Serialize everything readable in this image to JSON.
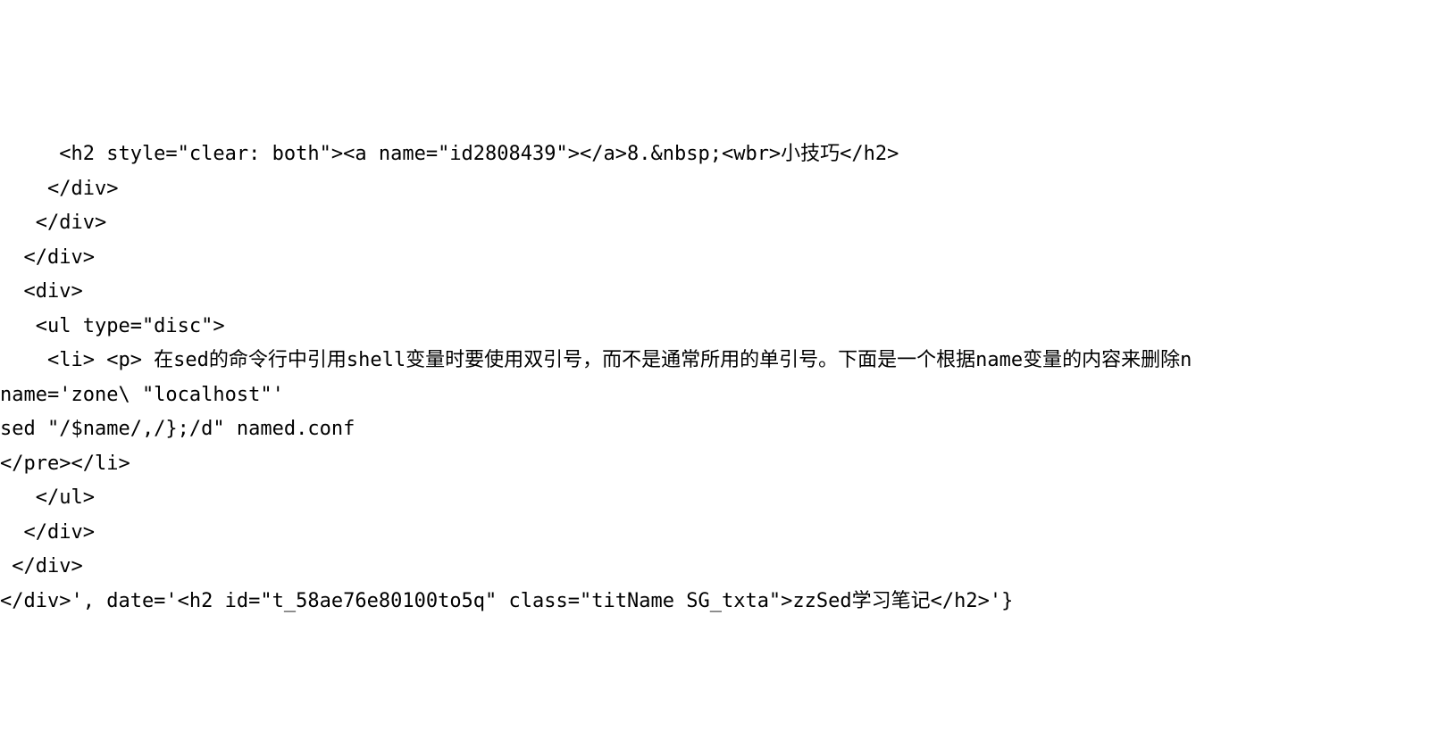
{
  "lines": [
    "     <h2 style=\"clear: both\"><a name=\"id2808439\"></a>8.&nbsp;<wbr>小技巧</h2>",
    "    </div>",
    "   </div>",
    "  </div>",
    "  <div>",
    "   <ul type=\"disc\">",
    "    <li> <p> 在sed的命令行中引用shell变量时要使用双引号，而不是通常所用的单引号。下面是一个根据name变量的内容来删除n",
    "name='zone\\ \"localhost\"'",
    "sed \"/$name/,/};/d\" named.conf",
    "</pre></li>",
    "   </ul>",
    "  </div>",
    " </div>",
    "</div>', date='<h2 id=\"t_58ae76e80100to5q\" class=\"titName SG_txta\">zzSed学习笔记</h2>'}"
  ]
}
